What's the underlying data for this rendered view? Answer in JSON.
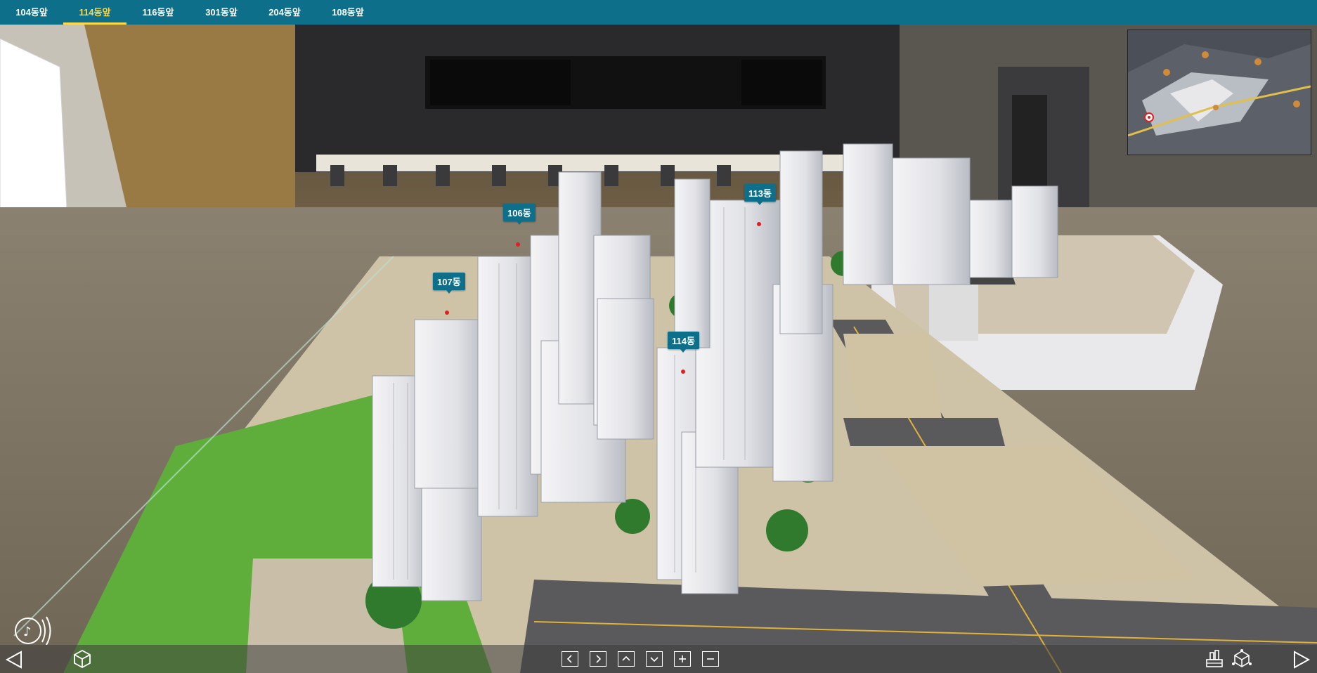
{
  "tabs": [
    {
      "label": "104동앞",
      "active": false
    },
    {
      "label": "114동앞",
      "active": true
    },
    {
      "label": "116동앞",
      "active": false
    },
    {
      "label": "301동앞",
      "active": false
    },
    {
      "label": "204동앞",
      "active": false
    },
    {
      "label": "108동앞",
      "active": false
    }
  ],
  "building_labels": {
    "b106": "106동",
    "b107": "107동",
    "b113": "113동",
    "b114": "114동"
  },
  "colors": {
    "accent": "#0d6f8a",
    "active_tab": "#ffd94a"
  },
  "controls": {
    "prev": "previous-scene",
    "next": "next-scene",
    "pan_left": "pan-left",
    "pan_right": "pan-right",
    "pan_up": "pan-up",
    "pan_down": "pan-down",
    "zoom_in": "zoom-in",
    "zoom_out": "zoom-out"
  }
}
